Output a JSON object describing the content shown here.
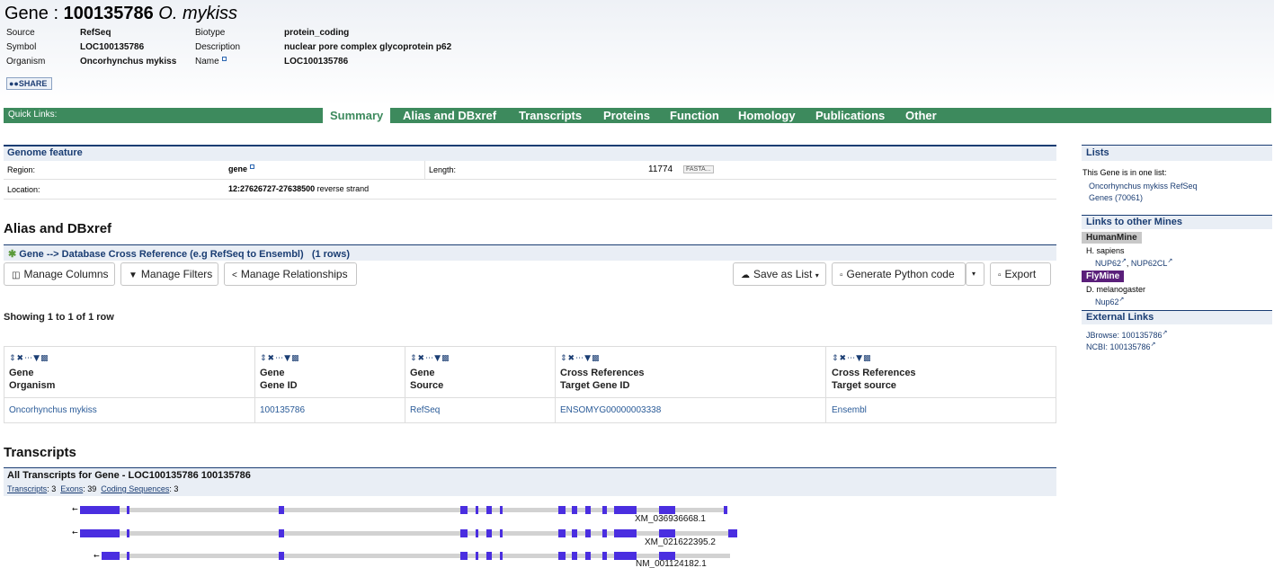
{
  "gene": {
    "prefix": "Gene : ",
    "id": "100135786",
    "species": "O. mykiss"
  },
  "summary_fields": {
    "source_label": "Source",
    "source_value": "RefSeq",
    "symbol_label": "Symbol",
    "symbol_value": "LOC100135786",
    "organism_label": "Organism",
    "organism_value": "Oncorhynchus mykiss",
    "biotype_label": "Biotype",
    "biotype_value": "protein_coding",
    "description_label": "Description",
    "description_value": "nuclear pore complex glycoprotein p62",
    "name_label": "Name",
    "name_value": "LOC100135786"
  },
  "share_label": "SHARE",
  "quick_links": {
    "label": "Quick Links:",
    "tabs": [
      "Summary",
      "Alias and DBxref",
      "Transcripts",
      "Proteins",
      "Function",
      "Homology",
      "Publications",
      "Other"
    ],
    "active": "Summary"
  },
  "genome_feature": {
    "title": "Genome feature",
    "region_label": "Region:",
    "region_value": "gene",
    "length_label": "Length:",
    "length_value": "11774",
    "fasta_label": "FASTA...",
    "location_label": "Location:",
    "location_value": "12:27626727-27638500",
    "strand": "reverse strand"
  },
  "alias": {
    "heading": "Alias and DBxref",
    "table_title": "Gene --> Database Cross Reference (e.g RefSeq to Ensembl)",
    "rows_note": "(1 rows)",
    "buttons": {
      "manage_columns": "Manage Columns",
      "manage_filters": "Manage Filters",
      "manage_relationships": "Manage Relationships",
      "save_as_list": "Save as List",
      "generate_python": "Generate Python code",
      "export": "Export"
    },
    "showing": "Showing 1 to 1 of 1 row",
    "columns": [
      {
        "line1": "Gene",
        "line2": "Organism"
      },
      {
        "line1": "Gene",
        "line2": "Gene ID"
      },
      {
        "line1": "Gene",
        "line2": "Source"
      },
      {
        "line1": "Cross References",
        "line2": "Target Gene ID"
      },
      {
        "line1": "Cross References",
        "line2": "Target source"
      }
    ],
    "row": [
      "Oncorhynchus mykiss",
      "100135786",
      "RefSeq",
      "ENSOMYG00000003338",
      "Ensembl"
    ]
  },
  "transcripts": {
    "heading": "Transcripts",
    "box_title": "All Transcripts for Gene - LOC100135786 100135786",
    "transcripts_label": "Transcripts",
    "transcripts_count": ": 3",
    "exons_label": "Exons",
    "exons_count": ": 39",
    "cds_label": "Coding Sequences",
    "cds_count": ": 3",
    "ids": [
      "XM_036936668.1",
      "XM_021622395.2",
      "NM_001124182.1"
    ],
    "exon_color": "#4a2ee0"
  },
  "sidebar": {
    "lists_title": "Lists",
    "lists_text": "This Gene is in one list:",
    "list_link_line1": "Oncorhynchus mykiss RefSeq",
    "list_link_line2": "Genes (70061)",
    "mines_title": "Links to other Mines",
    "humanmine": "HumanMine",
    "humanmine_species": "H. sapiens",
    "humanmine_link1": "NUP62",
    "humanmine_sep": ",",
    "humanmine_link2": "NUP62CL",
    "flymine": "FlyMine",
    "flymine_species": "D. melanogaster",
    "flymine_link": "Nup62",
    "external_title": "External Links",
    "jbrowse": "JBrowse: 100135786",
    "ncbi": "NCBI: 100135786"
  },
  "colors": {
    "quicklinks_bg": "#3d8a5d",
    "section_border": "#1a3d73",
    "flymine_bg": "#5a1f7a",
    "humanmine_bg": "#c8c8c8"
  }
}
